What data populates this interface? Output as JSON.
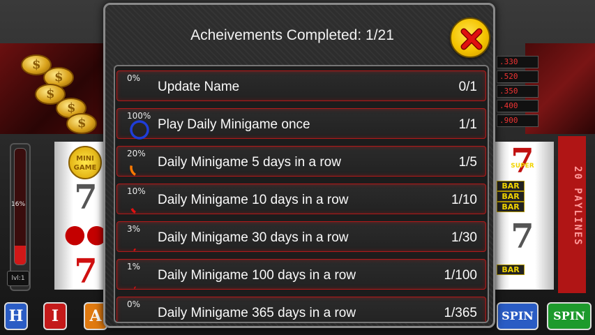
{
  "modal": {
    "title": "Acheivements Completed: 1/21",
    "close_icon": "close-x-icon",
    "accent_color": "#f4c300"
  },
  "achievements": [
    {
      "pct": "0%",
      "progress": 0.0,
      "name": "Update Name",
      "count": "0/1",
      "ring_color": "#e01010"
    },
    {
      "pct": "100%",
      "progress": 1.0,
      "name": "Play Daily Minigame once",
      "count": "1/1",
      "ring_color": "#1f3dd8"
    },
    {
      "pct": "20%",
      "progress": 0.2,
      "name": "Daily Minigame 5 days in a row",
      "count": "1/5",
      "ring_color": "#ff7a00"
    },
    {
      "pct": "10%",
      "progress": 0.1,
      "name": "Daily Minigame 10 days in a row",
      "count": "1/10",
      "ring_color": "#e01010"
    },
    {
      "pct": "3%",
      "progress": 0.03,
      "name": "Daily Minigame 30 days in a row",
      "count": "1/30",
      "ring_color": "#e01010"
    },
    {
      "pct": "1%",
      "progress": 0.01,
      "name": "Daily Minigame 100 days in a row",
      "count": "1/100",
      "ring_color": "#e01010"
    },
    {
      "pct": "0%",
      "progress": 0.0,
      "name": "Daily Minigame 365 days in a row",
      "count": "1/365",
      "ring_color": "#e01010"
    }
  ],
  "background": {
    "paytable": [
      ".330",
      ".520",
      ".350",
      ".400",
      ".900"
    ],
    "meter_pct": "16%",
    "meter_progress": 0.16,
    "level": "lvl:1",
    "mini_game": "MINI GAME",
    "paylines": "20 PAYLINES",
    "super_label": "SUPER",
    "bar_label": "BAR",
    "buttons": [
      "H",
      "I",
      "A"
    ],
    "spin_labels": [
      "SPIN",
      "SPIN"
    ]
  }
}
